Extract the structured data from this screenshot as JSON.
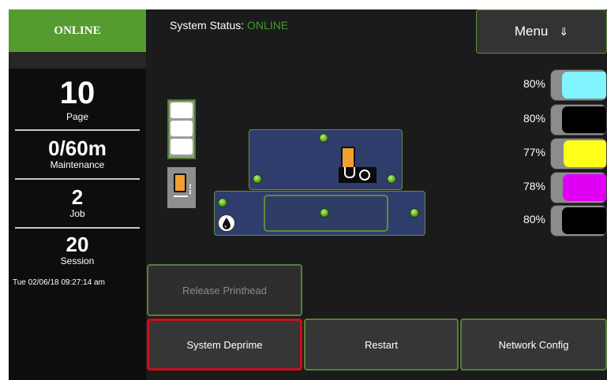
{
  "sidebar": {
    "banner": "ONLINE",
    "stats": [
      {
        "value": "10",
        "label": "Page"
      },
      {
        "value": "0/60m",
        "label": "Maintenance"
      },
      {
        "value": "2",
        "label": "Job"
      },
      {
        "value": "20",
        "label": "Session"
      }
    ],
    "timestamp": "Tue 02/06/18 09:27:14 am"
  },
  "header": {
    "status_label": "System Status:",
    "status_value": "ONLINE",
    "menu_label": "Menu",
    "menu_icon": "down-arrow-icon"
  },
  "ink_levels": [
    {
      "percent_text": "80%",
      "level": 0.8,
      "color": "#80f4ff"
    },
    {
      "percent_text": "80%",
      "level": 0.8,
      "color": "#000000"
    },
    {
      "percent_text": "77%",
      "level": 0.77,
      "color": "#ffff1a"
    },
    {
      "percent_text": "78%",
      "level": 0.78,
      "color": "#e000f4"
    },
    {
      "percent_text": "80%",
      "level": 0.8,
      "color": "#000000"
    }
  ],
  "buttons": {
    "release_printhead": "Release Printhead",
    "system_deprime": "System Deprime",
    "restart": "Restart",
    "network_config": "Network Config"
  },
  "colors": {
    "online_green": "#559b2f",
    "status_green": "#3f9b2f",
    "panel_blue": "#2e3d6b",
    "highlight_red": "#c8101a"
  }
}
